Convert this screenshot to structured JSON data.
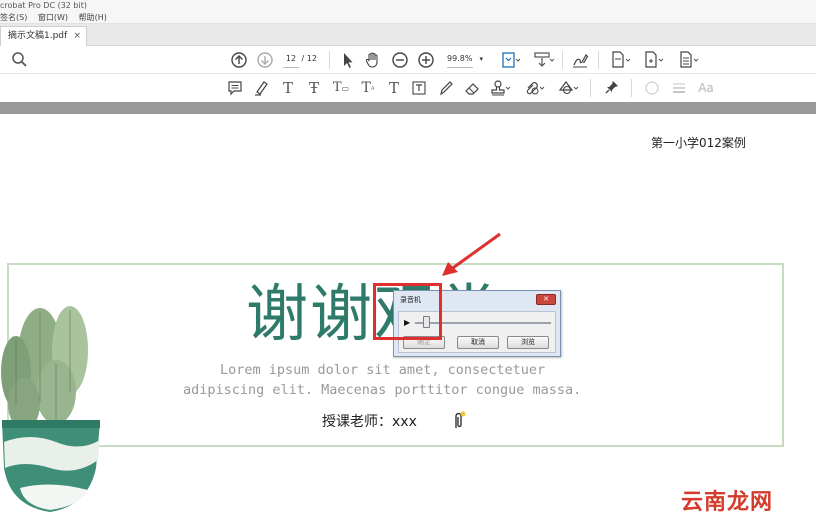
{
  "window": {
    "title": "crobat Pro DC (32 bit)"
  },
  "menu": {
    "items": [
      "签名(S)",
      "窗口(W)",
      "帮助(H)"
    ]
  },
  "tabs": [
    {
      "label": "摘示文稿1.pdf",
      "close": "×"
    }
  ],
  "toolbar": {
    "page_current": "12",
    "page_total": "/ 12",
    "zoom": "99.8%",
    "icons": [
      "zoom-tool-icon",
      "previous-page-icon",
      "next-page-icon",
      "select-arrow-icon",
      "hand-icon",
      "zoom-out-icon",
      "zoom-in-icon",
      "fit-page-icon",
      "scroll-mode-icon",
      "sign-icon",
      "export-icon",
      "file-icon",
      "comment-page-icon"
    ]
  },
  "annotation_toolbar": {
    "icons": [
      "sticky-note-icon",
      "highlight-icon",
      "text-underline-icon",
      "strikethrough-icon",
      "replace-text-icon",
      "insert-text-icon",
      "add-text-icon",
      "text-box-icon",
      "pencil-icon",
      "eraser-icon",
      "stamp-icon",
      "attach-icon",
      "shapes-icon",
      "pin-icon",
      "color-icon",
      "line-weight-icon",
      "font-icon"
    ],
    "font_label": "Aa"
  },
  "document": {
    "header": "第一小学012案例",
    "title": "谢谢观赏",
    "lorem_line1": "Lorem ipsum dolor sit amet, consectetuer",
    "lorem_line2": "adipiscing elit. Maecenas porttitor congue massa.",
    "teacher": "授课老师：xxx"
  },
  "dialog": {
    "title": "录音机",
    "close": "✕",
    "play": "▶",
    "record_button": "确定",
    "cancel_button": "取消",
    "browse_button": "浏览",
    "slider_position": 0.08
  },
  "watermark": "云南龙网",
  "colors": {
    "title_green": "#2e7a6b",
    "frame_green": "#c7dcc3",
    "highlight_red": "#e02f2f",
    "watermark_red": "#d33b2c"
  }
}
